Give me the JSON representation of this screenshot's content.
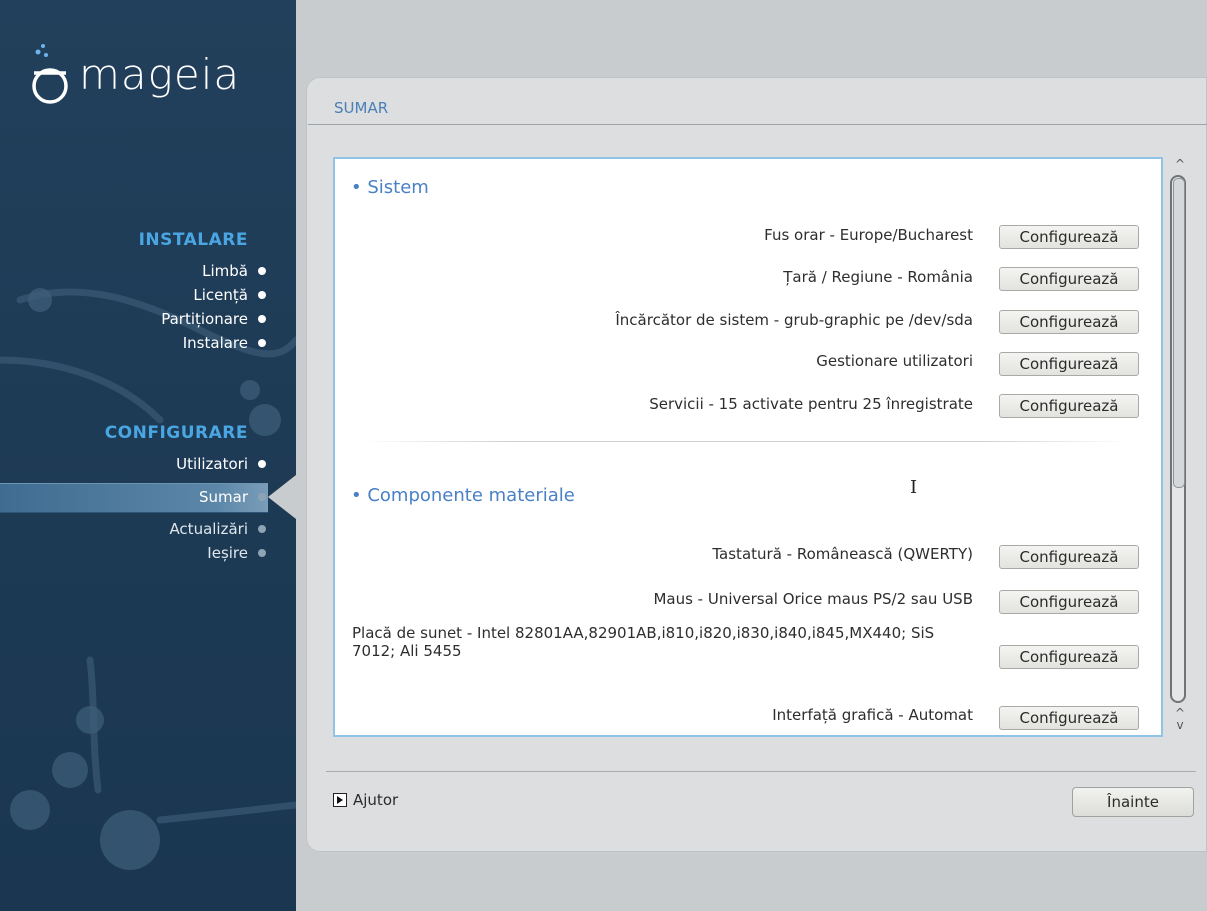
{
  "sidebar": {
    "logo_text": "mageia",
    "sections": [
      {
        "title": "INSTALARE"
      },
      {
        "title": "CONFIGURARE"
      }
    ],
    "install_items": [
      {
        "label": "Limbă",
        "done": true
      },
      {
        "label": "Licență",
        "done": true
      },
      {
        "label": "Partiționare",
        "done": true
      },
      {
        "label": "Instalare",
        "done": true
      }
    ],
    "config_items": [
      {
        "label": "Utilizatori",
        "done": true
      },
      {
        "label": "Sumar",
        "active": true
      },
      {
        "label": "Actualizări",
        "done": false
      },
      {
        "label": "Ieșire",
        "done": false
      }
    ]
  },
  "panel": {
    "title": "SUMAR"
  },
  "summary": {
    "button_label": "Configurează",
    "system_section": "• Sistem",
    "system_rows": [
      {
        "label": "Fus orar - Europe/Bucharest"
      },
      {
        "label": "Țară / Regiune - România"
      },
      {
        "label": "Încărcător de sistem - grub-graphic pe /dev/sda"
      },
      {
        "label": "Gestionare utilizatori"
      },
      {
        "label": "Servicii - 15 activate pentru 25 înregistrate"
      }
    ],
    "hardware_section": "• Componente materiale",
    "hardware_rows": [
      {
        "label": "Tastatură - Românească (QWERTY)"
      },
      {
        "label": "Maus - Universal Orice maus PS/2 sau USB"
      },
      {
        "label": "Placă de sunet - Intel 82801AA,82901AB,i810,i820,i830,i840,i845,MX440; SiS 7012; Ali 5455"
      },
      {
        "label": "Interfață grafică - Automat"
      }
    ]
  },
  "footer": {
    "help_label": "Ajutor",
    "next_label": "Înainte"
  },
  "colors": {
    "sidebar_bg": "#1e3b56",
    "section_accent": "#4aa6e3",
    "content_border": "#8fc3e8",
    "heading_blue": "#4a80c4"
  }
}
